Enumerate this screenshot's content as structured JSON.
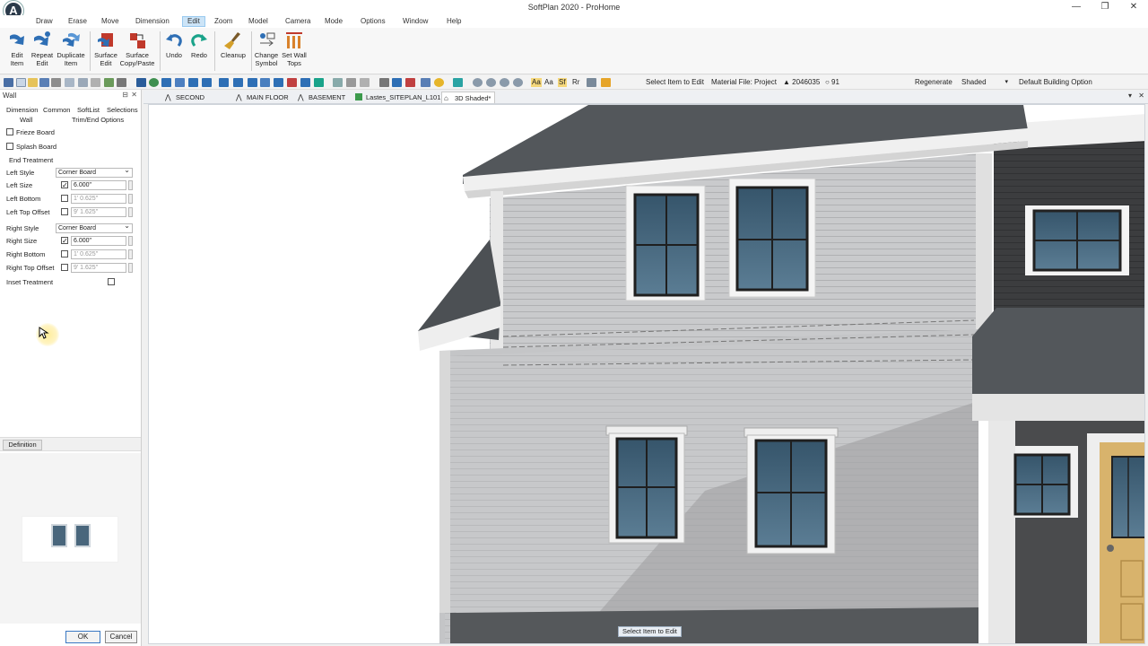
{
  "window": {
    "title": "SoftPlan 2020 - ProHome",
    "controls": [
      "—",
      "❐",
      "✕"
    ]
  },
  "menu": [
    "Draw",
    "Erase",
    "Move",
    "Dimension",
    "Edit",
    "Zoom",
    "Model",
    "Camera",
    "Mode",
    "Options",
    "Window",
    "Help"
  ],
  "menu_active": "Edit",
  "ribbon": [
    {
      "line1": "Edit",
      "line2": "Item"
    },
    {
      "line1": "Repeat",
      "line2": "Edit"
    },
    {
      "line1": "Duplicate",
      "line2": "Item"
    },
    {
      "line1": "Surface",
      "line2": "Edit"
    },
    {
      "line1": "Surface",
      "line2": "Copy/Paste"
    },
    {
      "line1": "Undo",
      "line2": ""
    },
    {
      "line1": "Redo",
      "line2": ""
    },
    {
      "line1": "Cleanup",
      "line2": ""
    },
    {
      "line1": "Change",
      "line2": "Symbol"
    },
    {
      "line1": "Set Wall",
      "line2": "Tops"
    }
  ],
  "toolbar2": {
    "prompt": "Select Item to Edit",
    "material": "Material File: Project",
    "count1": "▲ 2046035",
    "count2": "○ 91",
    "regenerate": "Regenerate",
    "shading": "Shaded",
    "building_option": "Default Building Option",
    "text_icons": [
      "Aa",
      "Aa",
      "Sf",
      "Rr"
    ]
  },
  "panel": {
    "title": "Wall",
    "close": "✕",
    "pin": "⊟",
    "tabs": [
      "Dimension",
      "Common",
      "SoftList",
      "Selections",
      "Wall",
      "Trim/End Options"
    ],
    "rows": {
      "frieze": "Frieze Board",
      "splash": "Splash Board",
      "end_treatment": "End Treatment",
      "left_style": "Left Style",
      "left_style_val": "Corner Board",
      "left_size": "Left Size",
      "left_size_val": "6.000\"",
      "left_bottom": "Left Bottom",
      "left_bottom_val": "1' 0.625\"",
      "left_top": "Left Top Offset",
      "left_top_val": "9' 1.625\"",
      "right_style": "Right Style",
      "right_style_val": "Corner Board",
      "right_size": "Right Size",
      "right_size_val": "6.000\"",
      "right_bottom": "Right Bottom",
      "right_bottom_val": "1' 0.625\"",
      "right_top": "Right Top Offset",
      "right_top_val": "9' 1.625\"",
      "inset": "Inset Treatment"
    },
    "definition": "Definition",
    "ok": "OK",
    "cancel": "Cancel"
  },
  "view_tabs": [
    "SECOND FLOOR*",
    "MAIN FLOOR",
    "BASEMENT",
    "Lastes_SITEPLAN_L101",
    "3D Shaded*"
  ],
  "view_tab_active": "3D Shaded*",
  "view_tab_controls": [
    "▾",
    "✕"
  ],
  "viewport_status": "Select Item to Edit",
  "colors": {
    "siding": "#c8c9cb",
    "roof": "#54585c",
    "trim": "#f2f2f2",
    "glass": "#4b6a80",
    "brown_siding": "#3a3b3d",
    "door": "#d7b16a"
  }
}
